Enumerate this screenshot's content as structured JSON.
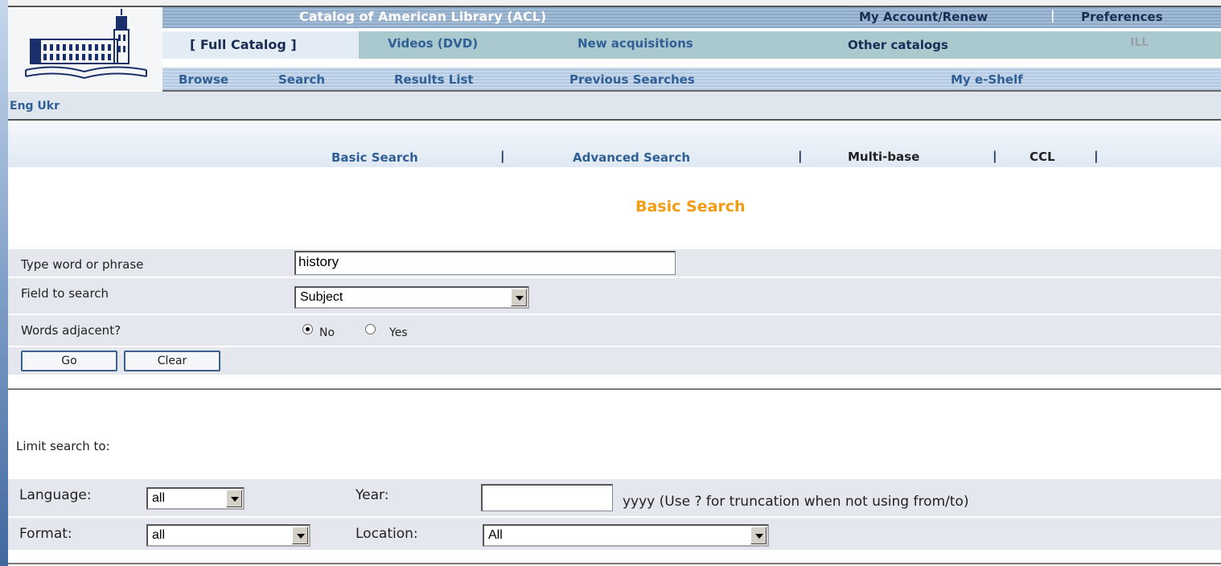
{
  "header": {
    "title": "Catalog of American Library (ACL)",
    "my_account": "My Account/Renew",
    "preferences": "Preferences",
    "separator": "|"
  },
  "nav": {
    "full_catalog": "[ Full Catalog ]",
    "videos": "Videos (DVD)",
    "new_acquisitions": "New acquisitions",
    "other_catalogs": "Other catalogs",
    "ill": "ILL",
    "browse": "Browse",
    "search": "Search",
    "results_list": "Results List",
    "previous_searches": "Previous Searches",
    "my_eshelf": "My e-Shelf"
  },
  "language_bar": {
    "label": "Eng Ukr"
  },
  "search_tabs": {
    "basic": "Basic Search",
    "advanced": "Advanced Search",
    "multibase": "Multi-base",
    "ccl": "CCL",
    "separator": "|"
  },
  "page_heading": "Basic Search",
  "form": {
    "word_label": "Type word or phrase",
    "word_value": "history",
    "field_label": "Field to search",
    "field_value": "Subject",
    "adjacent_label": "Words adjacent?",
    "adjacent_no": "No",
    "adjacent_yes": "Yes",
    "adjacent_selected": "No",
    "go_button": "Go",
    "clear_button": "Clear"
  },
  "limits": {
    "heading": "Limit search to:",
    "language_label": "Language:",
    "language_value": "all",
    "year_label": "Year:",
    "year_value": "",
    "year_hint": "yyyy (Use ? for truncation when not using from/to)",
    "format_label": "Format:",
    "format_value": "all",
    "location_label": "Location:",
    "location_value": "All"
  },
  "colors": {
    "heading_orange": "#f39c12",
    "nav_blue": "#2f5f95",
    "form_row_bg": "#e4e8ee"
  }
}
